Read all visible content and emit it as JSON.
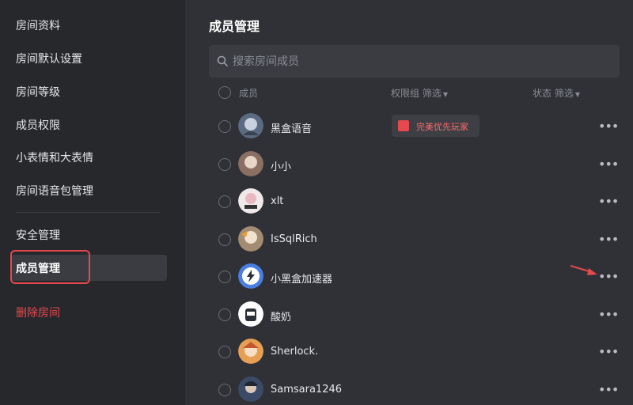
{
  "sidebar": {
    "items": [
      {
        "label": "房间资料"
      },
      {
        "label": "房间默认设置"
      },
      {
        "label": "房间等级"
      },
      {
        "label": "成员权限"
      },
      {
        "label": "小表情和大表情"
      },
      {
        "label": "房间语音包管理"
      },
      {
        "label": "安全管理"
      },
      {
        "label": "成员管理"
      },
      {
        "label": "删除房间"
      }
    ]
  },
  "main": {
    "title": "成员管理",
    "search": {
      "placeholder": "搜索房间成员"
    },
    "table": {
      "col_member": "成员",
      "col_group": "权限组 筛选",
      "col_status": "状态 筛选"
    },
    "members": [
      {
        "name": "黑盒语音",
        "badge": "完美优先玩家"
      },
      {
        "name": "小小"
      },
      {
        "name": "xlt"
      },
      {
        "name": "IsSqlRich"
      },
      {
        "name": "小黑盒加速器"
      },
      {
        "name": "酸奶"
      },
      {
        "name": "Sherlock."
      },
      {
        "name": "Samsara1246"
      }
    ],
    "more_glyph": "•••"
  },
  "colors": {
    "accent_red": "#e5484d",
    "sidebar_bg": "#27282c",
    "main_bg": "#2f3136"
  }
}
